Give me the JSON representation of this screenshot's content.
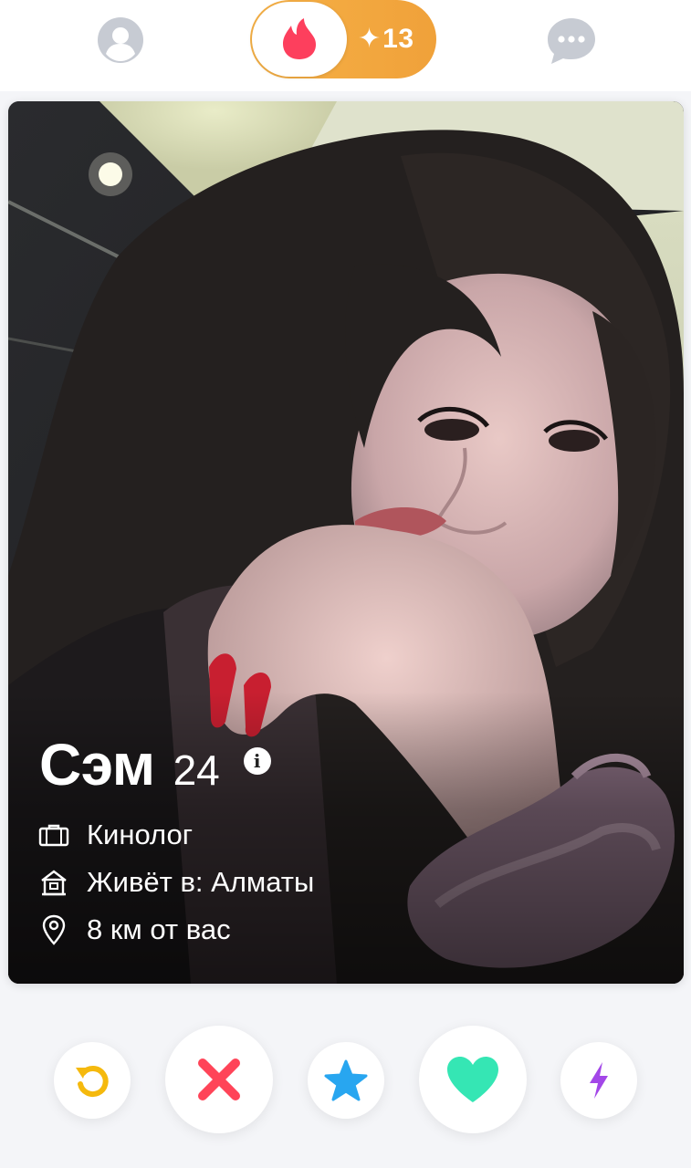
{
  "topbar": {
    "profile_icon": "user-profile-icon",
    "flame_icon": "tinder-flame-icon",
    "gold_spark": "✦",
    "gold_count": "13",
    "chat_icon": "chat-bubble-icon",
    "gold_color": "#f2a63c",
    "brand_color": "#fd3f5d"
  },
  "card": {
    "name": "Сэм",
    "age": "24",
    "info_icon": "info-icon",
    "info_glyph": "i",
    "job": "Кинолог",
    "lives": "Живёт в: Алматы",
    "distance": "8 км от вас"
  },
  "actions": {
    "rewind": {
      "icon": "rewind-icon",
      "color": "#f5b90d"
    },
    "nope": {
      "icon": "close-x-icon",
      "color": "#ff4458"
    },
    "super_like": {
      "icon": "star-icon",
      "color": "#28a6f0"
    },
    "like": {
      "icon": "heart-icon",
      "color": "#35e6b4"
    },
    "boost": {
      "icon": "lightning-bolt-icon",
      "color": "#a347e8"
    }
  }
}
